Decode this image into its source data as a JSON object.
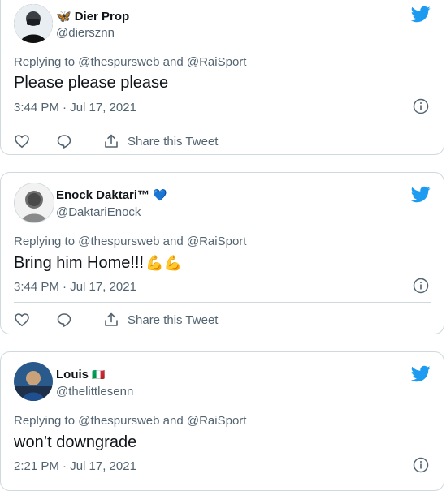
{
  "tweets": [
    {
      "display_name": "Dier Prop",
      "name_prefix_emoji": "🦋",
      "handle": "@diersznn",
      "replying_prefix": "Replying to",
      "replying_users": [
        "@thespursweb",
        "@RaiSport"
      ],
      "replying_joiner": "and",
      "text": "Please please please",
      "text_emoji": "",
      "time": "3:44 PM · Jul 17, 2021",
      "share_label": "Share this Tweet"
    },
    {
      "display_name": "Enock Daktari™",
      "name_suffix_emoji": "💙",
      "handle": "@DaktariEnock",
      "replying_prefix": "Replying to",
      "replying_users": [
        "@thespursweb",
        "@RaiSport"
      ],
      "replying_joiner": "and",
      "text": "Bring him Home!!!",
      "text_emoji": "💪💪",
      "time": "3:44 PM · Jul 17, 2021",
      "share_label": "Share this Tweet"
    },
    {
      "display_name": "Louis",
      "name_suffix_emoji": "🇮🇹",
      "handle": "@thelittlesenn",
      "replying_prefix": "Replying to",
      "replying_users": [
        "@thespursweb",
        "@RaiSport"
      ],
      "replying_joiner": "and",
      "text": "won’t downgrade",
      "text_emoji": "",
      "time": "2:21 PM · Jul 17, 2021"
    }
  ],
  "colors": {
    "twitter_blue": "#1d9bf0",
    "secondary_text": "#536471",
    "border": "#cfd9de"
  }
}
